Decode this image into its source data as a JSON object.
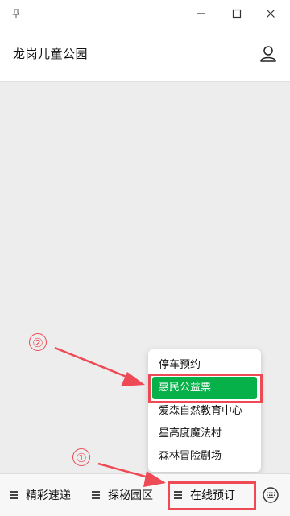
{
  "header": {
    "title": "龙岗儿童公园"
  },
  "bottom_menu": [
    {
      "label": "精彩速递"
    },
    {
      "label": "探秘园区"
    },
    {
      "label": "在线预订"
    }
  ],
  "popup": {
    "items": [
      {
        "label": "停车预约"
      },
      {
        "label": "惠民公益票"
      },
      {
        "label": "爱森自然教育中心"
      },
      {
        "label": "星高度魔法村"
      },
      {
        "label": "森林冒险剧场"
      }
    ],
    "selected_index": 1
  },
  "annotations": {
    "step1": "①",
    "step2": "②"
  },
  "colors": {
    "highlight": "#ee4a55",
    "selected": "#07b14a",
    "background": "#ededed"
  },
  "icons": [
    "pin-icon",
    "minimize-icon",
    "maximize-icon",
    "close-icon",
    "user-icon",
    "menu-icon",
    "keyboard-icon"
  ]
}
